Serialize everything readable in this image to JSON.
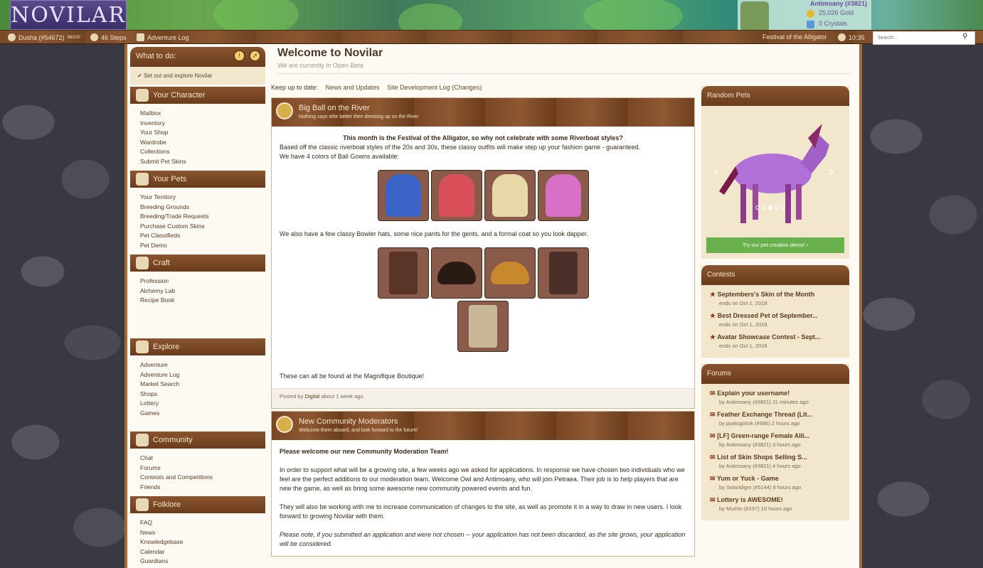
{
  "header": {
    "logo_text": "NOVILAR",
    "user": {
      "name": "Antimoany (#3821)",
      "gold": "25,026 Gold",
      "crystals": "0 Crystals"
    }
  },
  "topnav": {
    "user_label": "Dusha (#54672)",
    "user_sup": "98/100",
    "steps": "46 Steps",
    "adventure_log": "Adventure Log",
    "festival": "Festival of the Alligator",
    "time": "10:35",
    "search_placeholder": "Search..."
  },
  "sidebar": {
    "todo_title": "What to do:",
    "todo_item": "Set out and explore Novilar",
    "sections": [
      {
        "title": "Your Character",
        "items": [
          "Mailbox",
          "Inventory",
          "Your Shop",
          "Wardrobe",
          "Collections",
          "Submit Pet Skins"
        ]
      },
      {
        "title": "Your Pets",
        "items": [
          "Your Territory",
          "Breeding Grounds",
          "Breeding/Trade Requests",
          "Purchase Custom Skins",
          "Pet Classifieds",
          "Pet Demo"
        ]
      },
      {
        "title": "Craft",
        "items": [
          "Profession",
          "Alchemy Lab",
          "Recipe Book"
        ]
      },
      {
        "title": "Explore",
        "items": [
          "Adventure",
          "Adventure Log",
          "Market Search",
          "Shops",
          "Lottery",
          "Games"
        ]
      },
      {
        "title": "Community",
        "items": [
          "Chat",
          "Forums",
          "Contests and Competitions",
          "Friends"
        ]
      },
      {
        "title": "Folklore",
        "items": [
          "FAQ",
          "News",
          "Knowledgebase",
          "Calendar",
          "Guardians"
        ]
      }
    ]
  },
  "main": {
    "title": "Welcome to Novilar",
    "subtitle": "We are currently in Open Beta",
    "keep_label": "Keep up to date:",
    "keep_links": [
      "News and Updates",
      "Site Development Log (Changes)"
    ],
    "posts": [
      {
        "title": "Big Ball on the River",
        "subtitle": "Nothing says elite better then dressing up on the River",
        "intro": "This month is the Festival of the Alligator, so why not celebrate with some Riverboat styles?",
        "line1": "Based off the classic riverboat styles of the 20s and 30s, these classy outfits will make step up your fashion game - guaranteed.",
        "line2": "We have 4 colors of Ball Gowns available:",
        "line3": "We also have a few classy Bowler hats, some nice pants for the gents, and a formal coat so you look dapper.",
        "line4": "These can all be found at the Magnifique Boutique!",
        "footer_prefix": "Posted by",
        "footer_author": "Digital",
        "footer_time": "about 1 week ago"
      },
      {
        "title": "New Community Moderators",
        "subtitle": "Welcome them aboard, and look forward to the future!",
        "p1": "Please welcome our new Community Moderation Team!",
        "p2": "In order to support what will be a growing site, a few weeks ago we asked for applications. In response we have chosen two individuals who we feel are the perfect additions to our moderation team. Welcome Owl and Antimoany, who will join Petraea. Their job is to help players that are new the game, as well as bring some awesome new community powered events and fun.",
        "p3": "They will also be working with me to increase communication of changes to the site, as well as promote it in a way to draw in new users. I look forward to growing Novilar with them.",
        "p4": "Please note, if you submitted an application and were not chosen -- your application has not been discarded, as the site grows, your application will be considered."
      }
    ],
    "gown_colors": [
      "#3a64c8",
      "#d8505a",
      "#e8d8a8",
      "#d870c8"
    ],
    "mens_colors": [
      "#5a3424",
      "#2a1a14",
      "#c8882c",
      "#4a3028",
      "#c8b898"
    ]
  },
  "right": {
    "random_pets_title": "Random Pets",
    "demo_button": "Try our pet creation demo! ›",
    "contests_title": "Contests",
    "contests": [
      {
        "title": "Septembers's Skin of the Month",
        "sub": "ends on Oct 1, 2018"
      },
      {
        "title": "Best Dressed Pet of September...",
        "sub": "ends on Oct 1, 2018"
      },
      {
        "title": "Avatar Showcase Contest - Sept...",
        "sub": "ends on Oct 1, 2018"
      }
    ],
    "forums_title": "Forums",
    "forums": [
      {
        "title": "Explain your username!",
        "sub": "by Antimoany (#3821) 11 minutes ago"
      },
      {
        "title": "Feather Exchange Thread (Lit...",
        "sub": "by pyatugolnik (#686) 2 hours ago"
      },
      {
        "title": "[LF] Green-range Female Alli...",
        "sub": "by Antimoany (#3821) 3 hours ago"
      },
      {
        "title": "List of Skin Shops Selling S...",
        "sub": "by Antimoany (#3821) 4 hours ago"
      },
      {
        "title": "Yum or Yuck - Game",
        "sub": "by Solaridigm (#5144) 9 hours ago"
      },
      {
        "title": "Lottery is AWESOME!",
        "sub": "by Murhin (#157) 10 hours ago"
      }
    ]
  }
}
